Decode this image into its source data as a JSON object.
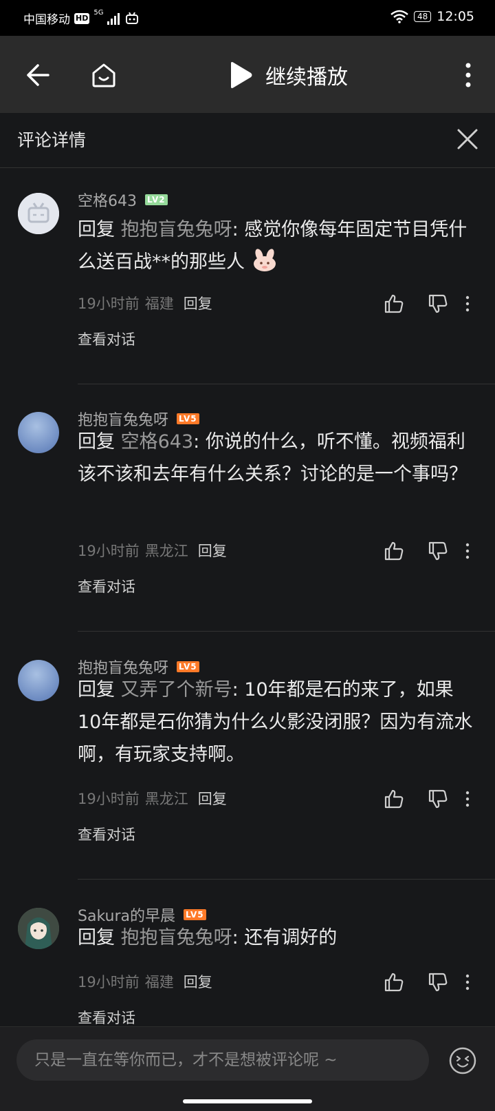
{
  "status_bar": {
    "carrier": "中国移动",
    "hd": "HD",
    "network": "5G",
    "battery": "48",
    "time": "12:05"
  },
  "toolbar": {
    "continue_label": "继续播放"
  },
  "header": {
    "title": "评论详情"
  },
  "comments": [
    {
      "username": "空格643",
      "level": "LV2",
      "reply_kw": "回复",
      "reply_to": "抱抱盲兔兔呀",
      "text": ": 感觉你像每年固定节目凭什么送百战**的那些人",
      "time": "19小时前",
      "location": "福建",
      "reply_btn": "回复",
      "view_conv": "查看对话"
    },
    {
      "username": "抱抱盲兔兔呀",
      "level": "LV5",
      "reply_kw": "回复",
      "reply_to": "空格643",
      "text": ": 你说的什么，听不懂。视频福利该不该和去年有什么关系？讨论的是一个事吗？",
      "time": "19小时前",
      "location": "黑龙江",
      "reply_btn": "回复",
      "view_conv": "查看对话"
    },
    {
      "username": "抱抱盲兔兔呀",
      "level": "LV5",
      "reply_kw": "回复",
      "reply_to": "又弄了个新号",
      "text": ": 10年都是石的来了，如果10年都是石你猜为什么火影没闭服？因为有流水啊，有玩家支持啊。",
      "time": "19小时前",
      "location": "黑龙江",
      "reply_btn": "回复",
      "view_conv": "查看对话"
    },
    {
      "username": "Sakura的早晨",
      "level": "LV5",
      "reply_kw": "回复",
      "reply_to": "抱抱盲兔兔呀",
      "text": ": 还有调好的",
      "time": "19小时前",
      "location": "福建",
      "reply_btn": "回复",
      "view_conv": "查看对话"
    }
  ],
  "bottom_bar": {
    "placeholder": "只是一直在等你而已，才不是想被评论呢 ~"
  },
  "colors": {
    "background": "#17181a",
    "toolbar": "#2b2b2b",
    "lv_green": "#95d99a",
    "lv_orange": "#ff7a28"
  }
}
